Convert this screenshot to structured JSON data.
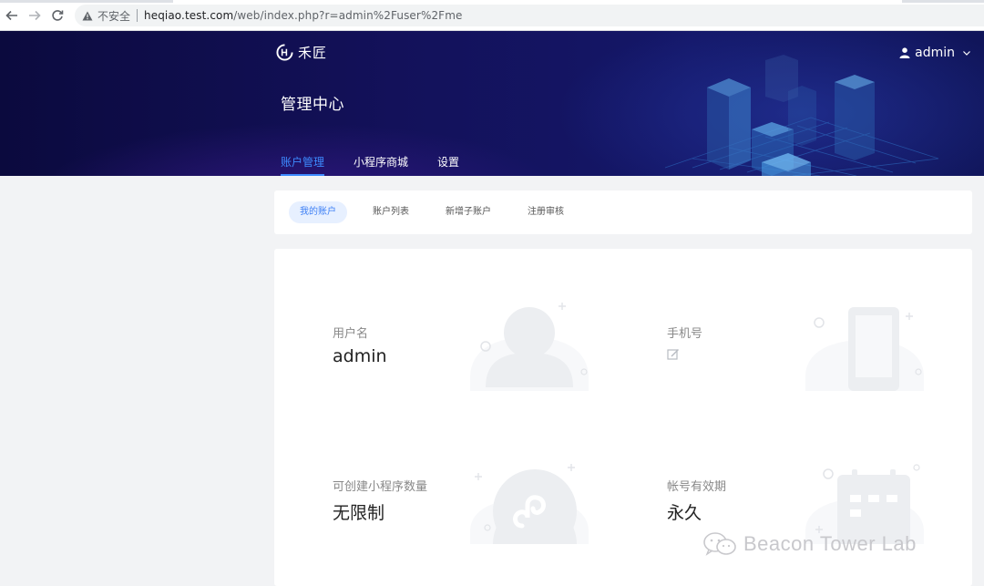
{
  "browser": {
    "insecure_label": "不安全",
    "url_host": "heqiao.test.com",
    "url_path": "/web/index.php?r=admin%2Fuser%2Fme"
  },
  "header": {
    "logo_text": "禾匠",
    "user_name": "admin",
    "title": "管理中心",
    "tabs": [
      {
        "label": "账户管理",
        "active": true
      },
      {
        "label": "小程序商城",
        "active": false
      },
      {
        "label": "设置",
        "active": false
      }
    ]
  },
  "subtabs": [
    {
      "label": "我的账户",
      "active": true
    },
    {
      "label": "账户列表",
      "active": false
    },
    {
      "label": "新增子账户",
      "active": false
    },
    {
      "label": "注册审核",
      "active": false
    }
  ],
  "info": {
    "username": {
      "label": "用户名",
      "value": "admin"
    },
    "phone": {
      "label": "手机号",
      "value": ""
    },
    "app_count": {
      "label": "可创建小程序数量",
      "value": "无限制"
    },
    "validity": {
      "label": "帐号有效期",
      "value": "永久"
    }
  },
  "watermark": {
    "text": "Beacon Tower Lab"
  },
  "colors": {
    "accent": "#3d8bff",
    "hero_dark": "#0b0a3e",
    "illustration": "#eceef1"
  }
}
